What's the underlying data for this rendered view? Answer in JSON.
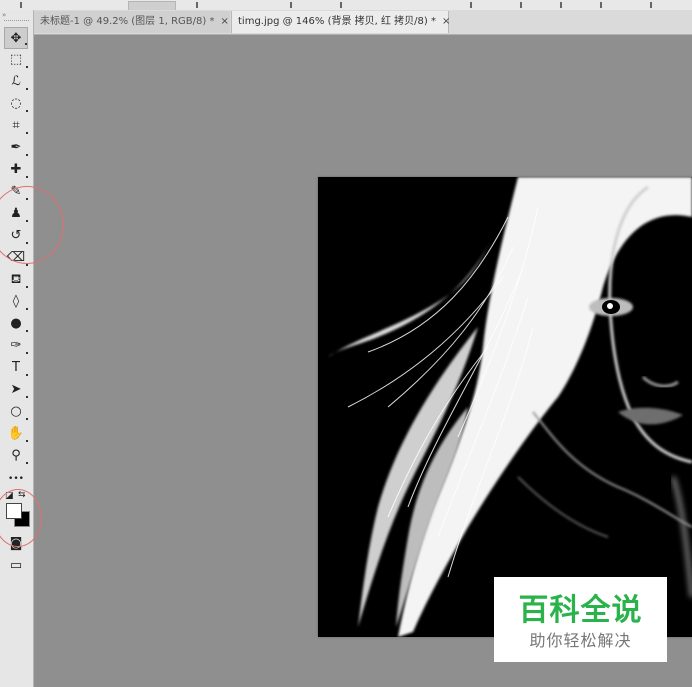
{
  "tabs": [
    {
      "label": "未标题-1 @ 49.2% (图层 1, RGB/8) *",
      "close": "×"
    },
    {
      "label": "timg.jpg @ 146% (背景 拷贝, 红 拷贝/8) *",
      "close": "×"
    }
  ],
  "toolbar": {
    "collapse": "»",
    "tools": [
      {
        "name": "move-tool",
        "glyph": "✥"
      },
      {
        "name": "marquee-tool",
        "glyph": "⬚"
      },
      {
        "name": "lasso-tool",
        "glyph": "ℒ"
      },
      {
        "name": "quick-selection-tool",
        "glyph": "◌"
      },
      {
        "name": "crop-tool",
        "glyph": "⌗"
      },
      {
        "name": "eyedropper-tool",
        "glyph": "✒"
      },
      {
        "name": "healing-brush-tool",
        "glyph": "✚"
      },
      {
        "name": "brush-tool",
        "glyph": "✎"
      },
      {
        "name": "clone-stamp-tool",
        "glyph": "♟"
      },
      {
        "name": "history-brush-tool",
        "glyph": "↺"
      },
      {
        "name": "eraser-tool",
        "glyph": "⌫"
      },
      {
        "name": "paint-bucket-tool",
        "glyph": "⛾"
      },
      {
        "name": "blur-tool",
        "glyph": "◊"
      },
      {
        "name": "dodge-tool",
        "glyph": "●"
      },
      {
        "name": "pen-tool",
        "glyph": "✑"
      },
      {
        "name": "type-tool",
        "glyph": "T"
      },
      {
        "name": "path-selection-tool",
        "glyph": "➤"
      },
      {
        "name": "ellipse-tool",
        "glyph": "○"
      },
      {
        "name": "hand-tool",
        "glyph": "✋"
      },
      {
        "name": "zoom-tool",
        "glyph": "⚲"
      },
      {
        "name": "edit-toolbar",
        "glyph": "•••"
      }
    ],
    "foreground_color": "#ffffff",
    "background_color": "#000000",
    "bottom_tools": [
      {
        "name": "quick-mask-button",
        "glyph": "◙"
      },
      {
        "name": "screen-mode-button",
        "glyph": "▭"
      }
    ]
  },
  "watermark": {
    "title": "百科全说",
    "subtitle": "助你轻松解决"
  }
}
